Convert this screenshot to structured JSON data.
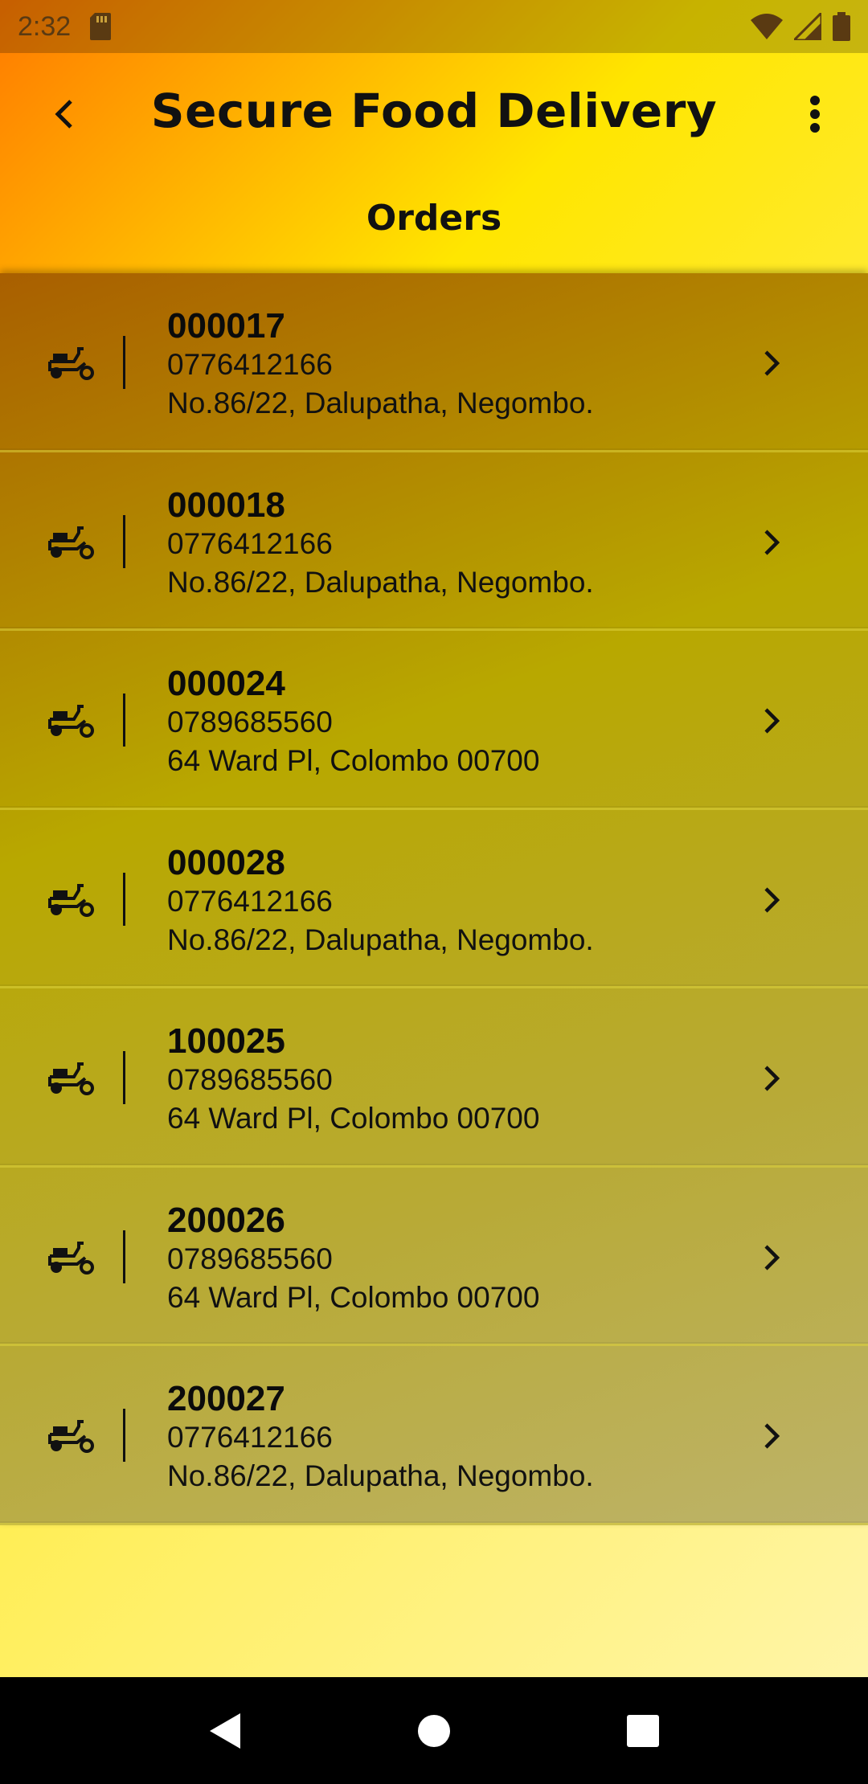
{
  "status_bar": {
    "time": "2:32",
    "icons": [
      "sd-card-icon",
      "wifi-icon",
      "signal-icon",
      "battery-icon"
    ]
  },
  "app_bar": {
    "title": "Secure Food Delivery",
    "back_icon": "chevron-left-icon",
    "menu_icon": "more-vertical-icon"
  },
  "page": {
    "subtitle": "Orders"
  },
  "orders": [
    {
      "id": "000017",
      "phone": "0776412166",
      "address": "No.86/22, Dalupatha, Negombo."
    },
    {
      "id": "000018",
      "phone": "0776412166",
      "address": "No.86/22, Dalupatha, Negombo."
    },
    {
      "id": "000024",
      "phone": "0789685560",
      "address": "64 Ward Pl, Colombo 00700"
    },
    {
      "id": "000028",
      "phone": "0776412166",
      "address": "No.86/22, Dalupatha, Negombo."
    },
    {
      "id": "100025",
      "phone": "0789685560",
      "address": "64 Ward Pl, Colombo 00700"
    },
    {
      "id": "200026",
      "phone": "0789685560",
      "address": "64 Ward Pl, Colombo 00700"
    },
    {
      "id": "200027",
      "phone": "0776412166",
      "address": "No.86/22, Dalupatha, Negombo."
    }
  ],
  "nav_bar": {
    "icons": [
      "back-triangle-icon",
      "home-circle-icon",
      "recents-square-icon"
    ]
  },
  "colors": {
    "accent_orange": "#ff7a00",
    "accent_yellow": "#ffe600",
    "text": "#111111"
  }
}
